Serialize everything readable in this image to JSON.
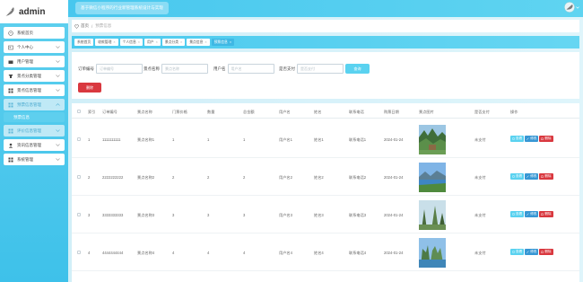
{
  "brand": {
    "name": "admin"
  },
  "header": {
    "system_title": "基于微信小程序的行业新管理系统设计与实现"
  },
  "sidebar": {
    "items": [
      {
        "label": "系统首页",
        "icon": "home-icon",
        "chevron": false
      },
      {
        "label": "个人中心",
        "icon": "user-card-icon",
        "chevron": true
      },
      {
        "label": "用户管理",
        "icon": "users-icon",
        "chevron": true
      },
      {
        "label": "景点分类管理",
        "icon": "category-icon",
        "chevron": true
      },
      {
        "label": "景点信息管理",
        "icon": "grid-icon",
        "chevron": true
      },
      {
        "label": "预票信息管理",
        "icon": "grid-icon",
        "chevron": true,
        "active": true
      },
      {
        "label": "预票信息",
        "submenu": true
      },
      {
        "label": "评价信息管理",
        "icon": "grid-icon",
        "chevron": true,
        "active": true
      },
      {
        "label": "资讯信息管理",
        "icon": "user-icon",
        "chevron": true
      },
      {
        "label": "系统管理",
        "icon": "grid-icon",
        "chevron": true
      }
    ]
  },
  "breadcrumb": {
    "home": "首页",
    "separator": "/",
    "current": "预票信息"
  },
  "tabs": [
    {
      "label": "系统首页",
      "closable": false
    },
    {
      "label": "收款管理",
      "closable": true
    },
    {
      "label": "个人信息",
      "closable": true
    },
    {
      "label": "用户",
      "closable": true
    },
    {
      "label": "景点分类",
      "closable": true
    },
    {
      "label": "景点信息",
      "closable": true
    },
    {
      "label": "预票信息",
      "closable": true,
      "active": true
    }
  ],
  "search": {
    "fields": [
      {
        "label": "订单编号",
        "placeholder": "订单编号"
      },
      {
        "label": "景点名称",
        "placeholder": "景点名称"
      },
      {
        "label": "用户名",
        "placeholder": "用户名"
      },
      {
        "label": "是否支付",
        "placeholder": "是否支付"
      }
    ],
    "query_label": "查询",
    "delete_label": "删除"
  },
  "table": {
    "columns": [
      "索引",
      "订单编号",
      "景点名称",
      "门票价格",
      "数量",
      "总金额",
      "用户名",
      "姓名",
      "联系电话",
      "购票日期",
      "景点图片",
      "是否支付",
      "操作"
    ],
    "rows": [
      {
        "index": "1",
        "order_no": "1111111111",
        "spot_name": "景点名称1",
        "price": "1",
        "qty": "1",
        "total": "1",
        "username": "用户名1",
        "name": "姓名1",
        "phone": "联系电话1",
        "date": "2024-01-24",
        "paid": "未支付"
      },
      {
        "index": "2",
        "order_no": "2222222222",
        "spot_name": "景点名称2",
        "price": "2",
        "qty": "2",
        "total": "2",
        "username": "用户名2",
        "name": "姓名2",
        "phone": "联系电话2",
        "date": "2024-01-24",
        "paid": "未支付"
      },
      {
        "index": "3",
        "order_no": "3333333333",
        "spot_name": "景点名称3",
        "price": "3",
        "qty": "3",
        "total": "3",
        "username": "用户名3",
        "name": "姓名3",
        "phone": "联系电话3",
        "date": "2024-01-24",
        "paid": "未支付"
      },
      {
        "index": "4",
        "order_no": "4444444444",
        "spot_name": "景点名称4",
        "price": "4",
        "qty": "4",
        "total": "4",
        "username": "用户名4",
        "name": "姓名4",
        "phone": "联系电话4",
        "date": "2024-01-24",
        "paid": "未支付"
      }
    ],
    "actions": {
      "view": "查看",
      "edit": "修改",
      "delete": "删除"
    }
  },
  "colors": {
    "accent": "#4ac9ee",
    "danger": "#d9383f",
    "primary": "#3797d4"
  }
}
